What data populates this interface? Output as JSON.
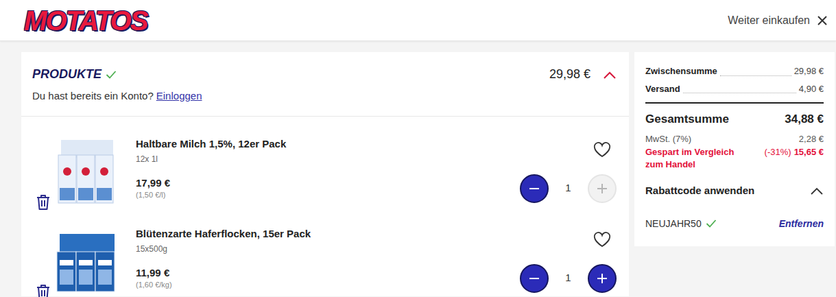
{
  "header": {
    "logo": "MOTATOS",
    "continue_label": "Weiter einkaufen"
  },
  "products_section": {
    "title": "PRODUKTE",
    "complete": true,
    "total": "29,98 €",
    "expanded": true,
    "login_prompt": "Du hast bereits ein Konto?",
    "login_link": "Einloggen"
  },
  "products": [
    {
      "name": "Haltbare Milch 1,5%, 12er Pack",
      "size": "12x 1l",
      "price": "17,99 €",
      "unit_price": "(1,50 €/l)",
      "quantity": "1",
      "favorite": false,
      "can_increase": false,
      "kind": "milk"
    },
    {
      "name": "Blütenzarte Haferflocken, 15er Pack",
      "size": "15x500g",
      "price": "11,99 €",
      "unit_price": "(1,60 €/kg)",
      "quantity": "1",
      "favorite": false,
      "can_increase": true,
      "kind": "oats"
    }
  ],
  "summary": {
    "subtotal_label": "Zwischensumme",
    "subtotal": "29,98 €",
    "shipping_label": "Versand",
    "shipping": "4,90 €",
    "total_label": "Gesamtsumme",
    "total": "34,88 €",
    "vat_label": "MwSt. (7%)",
    "vat": "2,28 €",
    "savings_label": "Gespart im Vergleich zum Handel",
    "savings_percent": "(-31%)",
    "savings": "15,65 €"
  },
  "discount": {
    "label": "Rabattcode anwenden",
    "expanded": true,
    "code": "NEUJAHR50",
    "valid": true,
    "remove_label": "Entfernen"
  }
}
